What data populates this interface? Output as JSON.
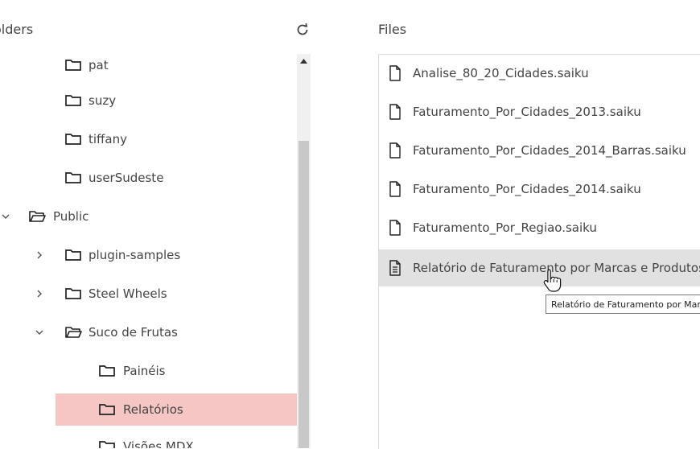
{
  "folders_panel": {
    "title": "olders",
    "tree": [
      {
        "label": "pat",
        "expanded": false
      },
      {
        "label": "suzy",
        "expanded": false
      },
      {
        "label": "tiffany",
        "expanded": false
      },
      {
        "label": "userSudeste",
        "expanded": false
      },
      {
        "label": "Public",
        "expanded": true
      },
      {
        "label": "plugin-samples",
        "expanded": false
      },
      {
        "label": "Steel Wheels",
        "expanded": false
      },
      {
        "label": "Suco de Frutas",
        "expanded": true
      },
      {
        "label": "Painéis",
        "expanded": false
      },
      {
        "label": "Relatórios",
        "expanded": false,
        "selected": true
      },
      {
        "label": "Visões MDX",
        "expanded": false
      }
    ]
  },
  "files_panel": {
    "title": "Files",
    "files": [
      {
        "name": "Analise_80_20_Cidades.saiku",
        "type": "saiku"
      },
      {
        "name": "Faturamento_Por_Cidades_2013.saiku",
        "type": "saiku"
      },
      {
        "name": "Faturamento_Por_Cidades_2014_Barras.saiku",
        "type": "saiku"
      },
      {
        "name": "Faturamento_Por_Cidades_2014.saiku",
        "type": "saiku"
      },
      {
        "name": "Faturamento_Por_Regiao.saiku",
        "type": "saiku"
      },
      {
        "name": "Relatório de Faturamento por Marcas e Produtos",
        "type": "report",
        "hovered": true
      }
    ]
  },
  "tooltip": {
    "text": "Relatório de Faturamento por Marcas e Produtos"
  },
  "colors": {
    "selected_folder_bg": "#f5c6c4",
    "hover_file_bg": "#e1e1e1"
  }
}
